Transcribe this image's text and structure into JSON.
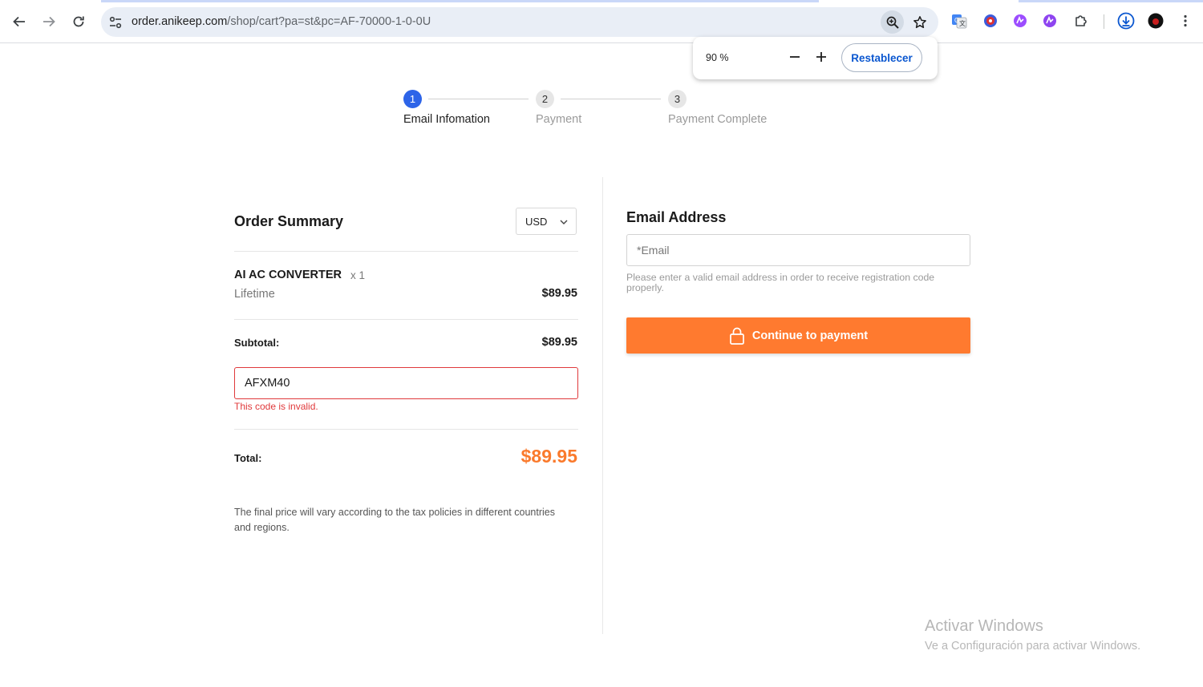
{
  "browser": {
    "url_host": "order.anikeep.com",
    "url_path": "/shop/cart?pa=st&pc=AF-70000-1-0-0U",
    "icons": [
      "back-arrow-icon",
      "forward-arrow-icon",
      "reload-icon",
      "site-settings-icon",
      "zoom-icon",
      "bookmark-star-icon",
      "google-translate-icon",
      "extension-shield-icon",
      "extension-purple-icon",
      "extension-purple-2-icon",
      "extensions-puzzle-icon",
      "download-icon",
      "profile-avatar-icon",
      "more-menu-icon"
    ]
  },
  "zoom_popup": {
    "percent_label": "90 %",
    "reset_label": "Restablecer"
  },
  "steps": [
    {
      "number": "1",
      "label": "Email Infomation",
      "state": "active"
    },
    {
      "number": "2",
      "label": "Payment",
      "state": "inactive"
    },
    {
      "number": "3",
      "label": "Payment Complete",
      "state": "inactive"
    }
  ],
  "order": {
    "title": "Order Summary",
    "currency": "USD",
    "product_name": "AI AC CONVERTER",
    "product_qty": "x 1",
    "product_term": "Lifetime",
    "product_price": "$89.95",
    "subtotal_label": "Subtotal:",
    "subtotal_value": "$89.95",
    "coupon_value": "AFXM40",
    "coupon_error": "This code is invalid.",
    "total_label": "Total:",
    "total_value": "$89.95",
    "disclaimer": "The final price will vary according to the tax policies in different countries and regions."
  },
  "email": {
    "title": "Email Address",
    "placeholder": "*Email",
    "hint": "Please enter a valid email address in order to receive registration code properly.",
    "continue_label": "Continue to payment"
  },
  "colors": {
    "accent_orange": "#ff7a2f",
    "step_blue": "#2d64e8",
    "error_red": "#e0393b"
  },
  "watermark": {
    "title": "Activar Windows",
    "subtitle": "Ve a Configuración para activar Windows."
  }
}
